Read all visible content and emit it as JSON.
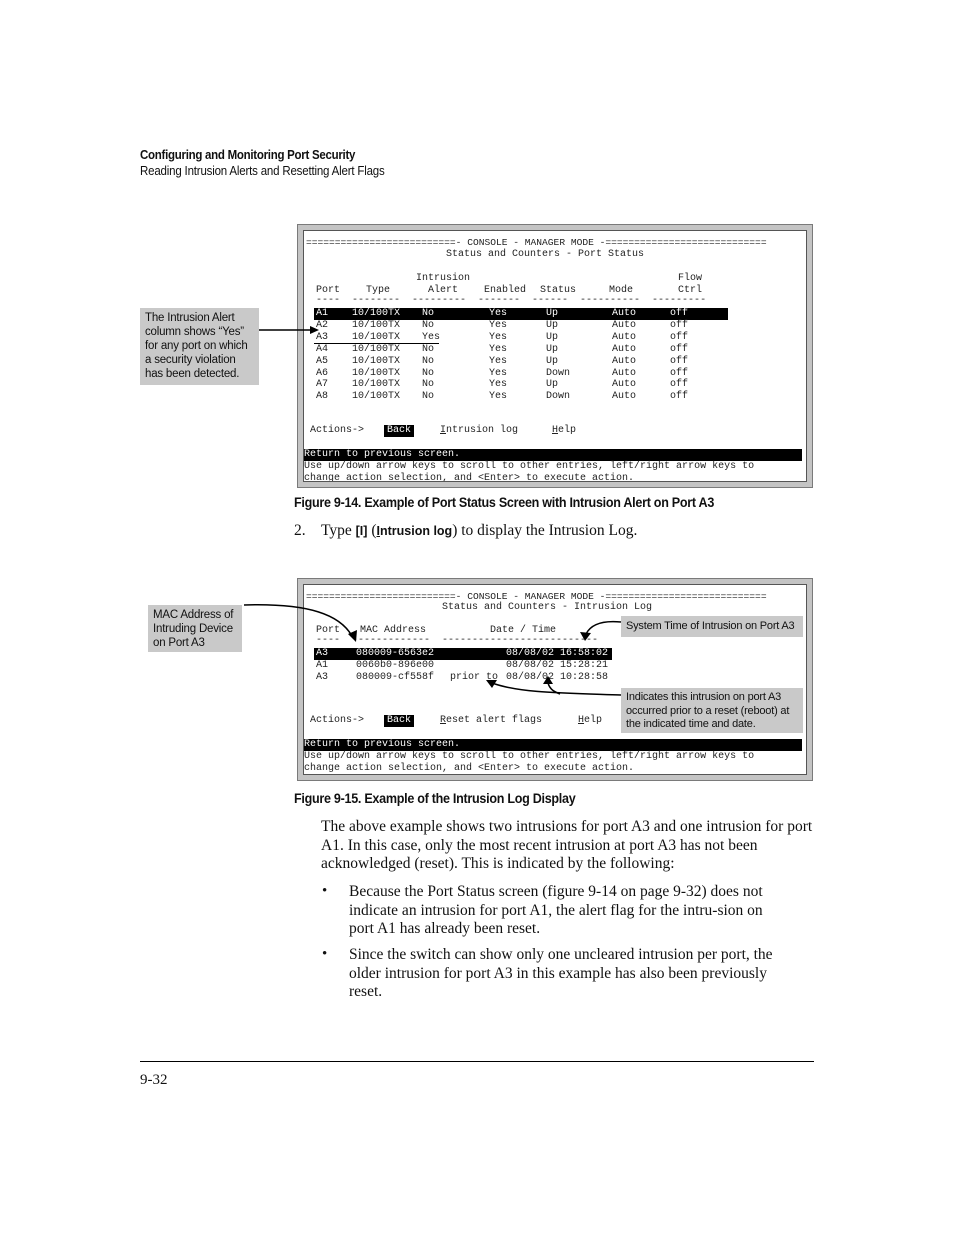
{
  "header": {
    "title": "Configuring and Monitoring Port Security",
    "subtitle": "Reading Intrusion Alerts and Resetting Alert Flags"
  },
  "figure1": {
    "console": {
      "banner": "==========================- CONSOLE - MANAGER MODE -============================",
      "screen_title": "Status and Counters - Port Status",
      "headers_line1": "                 Intrusion                                         Flow",
      "headers_line2": "  Port     Type    Alert    Enabled  Status     Mode        Ctrl",
      "headers_rule": "  ----  --------  ---------  -------  ------  ----------  ---------",
      "columns": [
        "Port",
        "Type",
        "Intrusion Alert",
        "Enabled",
        "Status",
        "Mode",
        "Flow Ctrl"
      ],
      "rows": [
        {
          "port": "A1",
          "type": "10/100TX",
          "alert": "No",
          "enabled": "Yes",
          "status": "Up",
          "mode": "Auto",
          "flow": "off",
          "selected": true
        },
        {
          "port": "A2",
          "type": "10/100TX",
          "alert": "No",
          "enabled": "Yes",
          "status": "Up",
          "mode": "Auto",
          "flow": "off"
        },
        {
          "port": "A3",
          "type": "10/100TX",
          "alert": "Yes",
          "enabled": "Yes",
          "status": "Up",
          "mode": "Auto",
          "flow": "off"
        },
        {
          "port": "A4",
          "type": "10/100TX",
          "alert": "No",
          "enabled": "Yes",
          "status": "Up",
          "mode": "Auto",
          "flow": "off"
        },
        {
          "port": "A5",
          "type": "10/100TX",
          "alert": "No",
          "enabled": "Yes",
          "status": "Up",
          "mode": "Auto",
          "flow": "off"
        },
        {
          "port": "A6",
          "type": "10/100TX",
          "alert": "No",
          "enabled": "Yes",
          "status": "Down",
          "mode": "Auto",
          "flow": "off"
        },
        {
          "port": "A7",
          "type": "10/100TX",
          "alert": "No",
          "enabled": "Yes",
          "status": "Up",
          "mode": "Auto",
          "flow": "off"
        },
        {
          "port": "A8",
          "type": "10/100TX",
          "alert": "No",
          "enabled": "Yes",
          "status": "Down",
          "mode": "Auto",
          "flow": "off"
        }
      ],
      "actions_label": "Actions->",
      "actions": [
        "Back",
        "Intrusion log",
        "Help"
      ],
      "status_line": "Return to previous screen.",
      "help_line1": "Use up/down arrow keys to scroll to other entries, left/right arrow keys to",
      "help_line2": "change action selection, and <Enter> to execute action."
    },
    "callout": "The Intrusion Alert column shows “Yes” for any port on which a security violation has been detected.",
    "caption": "Figure 9-14. Example of Port Status Screen with Intrusion Alert on Port A3"
  },
  "step2": {
    "number": "2.",
    "pre": "Type ",
    "key": "[I]",
    "mid": " (",
    "cmd_first": "I",
    "cmd_rest": "ntrusion log",
    "post": ") to display the Intrusion Log."
  },
  "figure2": {
    "console": {
      "banner": "==========================- CONSOLE - MANAGER MODE -============================",
      "screen_title": "Status and Counters - Intrusion Log",
      "headers_line": "  Port   MAC Address            Date / Time",
      "headers_rule": "  ----   -------------   --------------------------",
      "columns": [
        "Port",
        "MAC Address",
        "Date / Time"
      ],
      "rows": [
        {
          "port": "A3",
          "mac": "080009-6563e2",
          "prefix": "",
          "datetime": "08/08/02 16:58:02",
          "selected": true
        },
        {
          "port": "A1",
          "mac": "0060b0-896e00",
          "prefix": "",
          "datetime": "08/08/02 15:28:21"
        },
        {
          "port": "A3",
          "mac": "080009-cf558f",
          "prefix": "prior to",
          "datetime": "08/08/02 10:28:58"
        }
      ],
      "actions_label": "Actions->",
      "actions": [
        "Back",
        "Reset alert flags",
        "Help"
      ],
      "status_line": "Return to previous screen.",
      "help_line1": "Use up/down arrow keys to scroll to other entries, left/right arrow keys to",
      "help_line2": "change action selection, and <Enter> to execute action."
    },
    "callout_mac": "MAC Address of Intruding Device on Port A3",
    "callout_time": "System Time of Intrusion on Port A3",
    "callout_prior": "Indicates this intrusion on port A3 occurred prior to a reset (reboot) at the indicated time and date.",
    "caption": "Figure 9-15. Example of the Intrusion Log Display"
  },
  "body": {
    "paragraph": "The above example shows two intrusions for port A3 and one intrusion for port A1. In this case, only the most recent intrusion at port A3 has not been acknowledged (reset). This is indicated by the following:",
    "bullets": [
      "Because the Port Status screen (figure 9-14 on page 9-32) does not indicate an intrusion for port A1, the alert flag for the intru-sion on port A1 has already been reset.",
      "Since the switch can show only one uncleared intrusion per port, the older intrusion for port A3 in this example has also been previously reset."
    ],
    "bullet_symbol": "•"
  },
  "footer": {
    "page_number": "9-32"
  }
}
